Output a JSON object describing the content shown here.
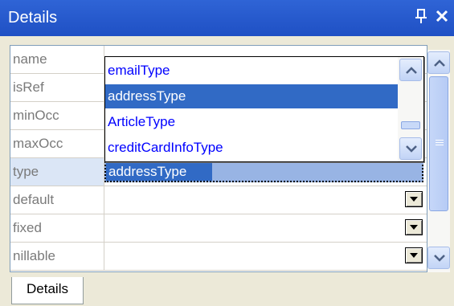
{
  "window": {
    "title": "Details",
    "pin_icon": "pin-icon",
    "close_icon": "close-icon"
  },
  "properties": [
    {
      "name": "name",
      "value": ""
    },
    {
      "name": "isRef",
      "value": ""
    },
    {
      "name": "minOcc",
      "value": ""
    },
    {
      "name": "maxOcc",
      "value": ""
    },
    {
      "name": "type",
      "value": "addressType"
    },
    {
      "name": "default",
      "value": ""
    },
    {
      "name": "fixed",
      "value": ""
    },
    {
      "name": "nillable",
      "value": ""
    }
  ],
  "selected_row": "type",
  "dropdown": {
    "items": [
      "emailType",
      "addressType",
      "ArticleType",
      "creditCardInfoType"
    ],
    "highlighted": "addressType"
  },
  "tabs": [
    "Details"
  ],
  "colors": {
    "title_bar": "#2f64d6",
    "selection": "#316ac5",
    "list_text": "#0000ff",
    "grid_label": "#7a7a7a"
  }
}
